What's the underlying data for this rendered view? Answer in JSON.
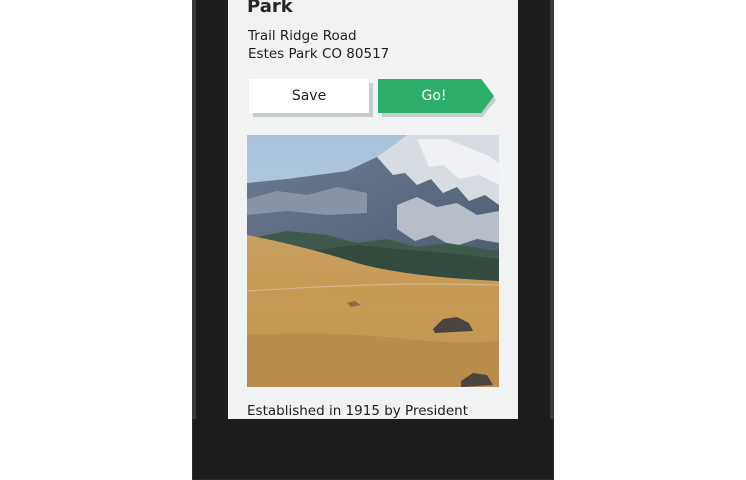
{
  "place": {
    "title": "Park",
    "address_line1": "Trail Ridge Road",
    "address_line2": "Estes Park CO 80517",
    "description": "Established in 1915 by President"
  },
  "actions": {
    "save_label": "Save",
    "go_label": "Go!"
  },
  "photo": {
    "alt": "Rocky Mountain landscape with snowy peak and golden tundra"
  },
  "colors": {
    "go_button": "#2daf6c",
    "screen_background": "#f0f2f3",
    "device_frame": "#1c1c1c"
  }
}
